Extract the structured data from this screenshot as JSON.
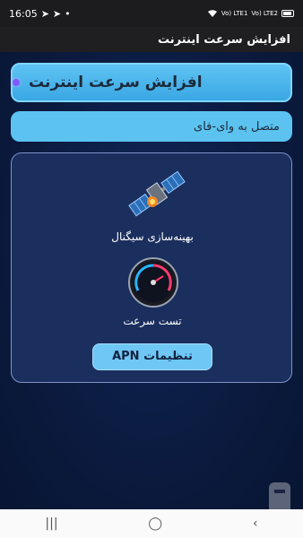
{
  "status_bar": {
    "time": "16:05",
    "signal_label_1": "Vo)\nLTE1",
    "signal_label_2": "Vo)\nLTE2"
  },
  "app_bar": {
    "title": "افزایش سرعت اینترنت"
  },
  "header": {
    "title": "افزایش سرعت اینترنت"
  },
  "wifi": {
    "status": "متصل به وای-فای"
  },
  "panel": {
    "signal_label": "بهینه‌سازی سیگنال",
    "speed_label": "تست سرعت",
    "apn_button": "تنظیمات APN"
  },
  "colors": {
    "accent": "#5cc3f0",
    "background": "#0b1a3e",
    "panel": "#1b2f5e"
  },
  "icons": [
    "satellite-icon",
    "speedometer-icon",
    "wifi-icon",
    "battery-icon",
    "app-logo-icon"
  ]
}
